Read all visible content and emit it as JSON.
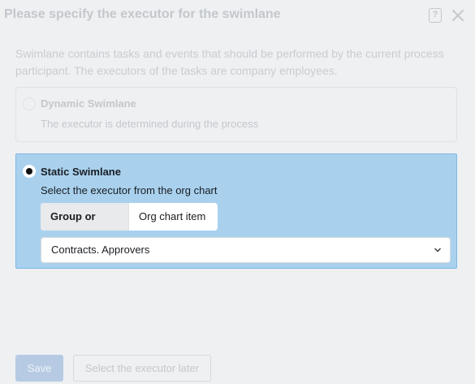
{
  "dialog": {
    "title": "Please specify the executor for the swimlane",
    "help_icon_glyph": "?",
    "description": "Swimlane contains tasks and events that should be performed by the current process participant. The executors of the tasks are company employees."
  },
  "options": {
    "dynamic": {
      "title": "Dynamic Swimlane",
      "subtitle": "The executor is determined during the process",
      "selected": false
    },
    "static": {
      "title": "Static Swimlane",
      "subtitle": "Select the executor from the org chart",
      "selected": true,
      "tabs": [
        {
          "label": "Group or Role",
          "active": true
        },
        {
          "label": "Org chart item",
          "active": false
        }
      ],
      "select_value": "Contracts. Approvers"
    }
  },
  "footer": {
    "save_label": "Save",
    "later_label": "Select the executor later"
  },
  "colors": {
    "selected_bg": "#a9d1ee",
    "save_bg": "#b6cbe3"
  }
}
